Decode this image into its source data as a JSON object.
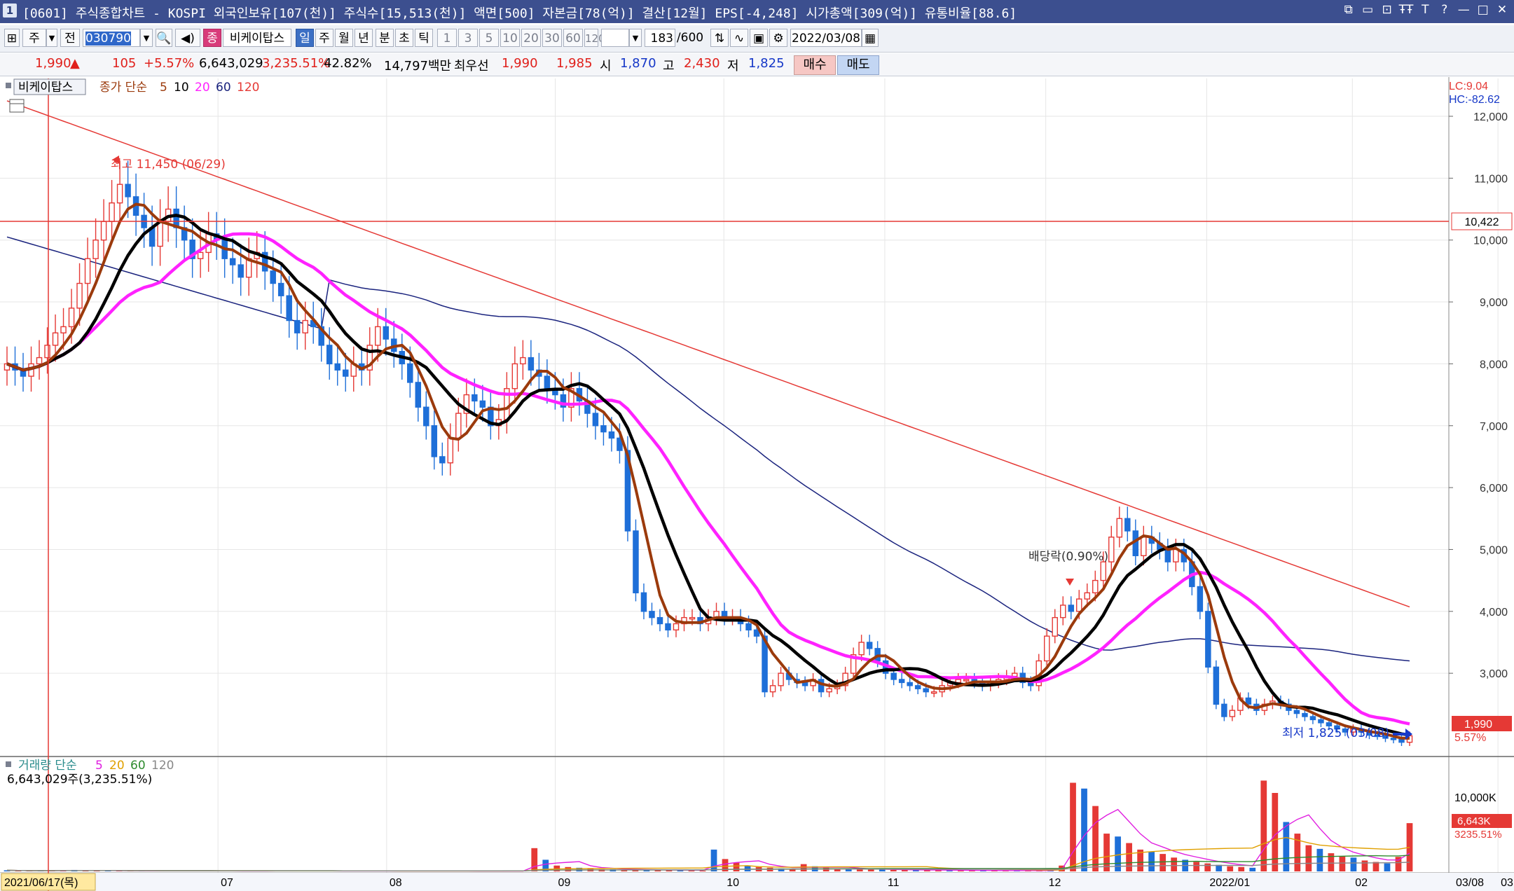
{
  "window": {
    "number": "1",
    "title": "[0601] 주식종합차트 - KOSPI 외국인보유[107(천)] 주식수[15,513(천)] 액면[500] 자본금[78(억)] 결산[12월] EPS[-4,248] 시가총액[309(억)] 유통비율[88.6]",
    "controls": [
      "⧉",
      "▭",
      "⊡",
      "ŦŦ",
      "T",
      "?",
      "—",
      "□",
      "✕"
    ]
  },
  "toolbar": {
    "period_selector": "주",
    "prev_button": "전",
    "code_input": "030790",
    "stock_badge": "종",
    "stock_name": "비케이탑스",
    "period_tabs": [
      "일",
      "주",
      "월",
      "년",
      "분",
      "초",
      "틱"
    ],
    "active_period": "일",
    "minute_values": [
      "1",
      "3",
      "5",
      "10",
      "20",
      "30",
      "60",
      "120"
    ],
    "count_display": "183",
    "count_total": "/600",
    "date_input": "2022/03/08"
  },
  "quote": {
    "price": "1,990",
    "direction": "▲",
    "change": "105",
    "change_pct": "+5.57%",
    "volume": "6,643,029",
    "volume_ratio": "3,235.51%",
    "turnover": "42.82%",
    "trade_amount": "14,797백만",
    "priority_label": "최우선",
    "ask": "1,990",
    "bid": "1,985",
    "open_label": "시",
    "open": "1,870",
    "high_label": "고",
    "high": "2,430",
    "low_label": "저",
    "low": "1,825",
    "buy_button": "매수",
    "sell_button": "매도"
  },
  "price_panel": {
    "stock_tag": "비케이탑스",
    "legend_prefix": "종가 단순",
    "ma_labels": [
      "5",
      "10",
      "20",
      "60",
      "120"
    ],
    "ma_colors": [
      "#9b3a0c",
      "#000000",
      "#ff22ff",
      "#1a237e",
      "#e53935"
    ],
    "lc": "LC:9.04",
    "hc": "HC:-82.62",
    "high_marker": "최고 11,450 (06/29)",
    "low_marker": "최저 1,825 (03/08)",
    "dividend_marker": "배당락(0.90%)",
    "crosshair_value": "10,422",
    "current_price": "1,990",
    "current_pct": "5.57%"
  },
  "volume_panel": {
    "legend_prefix": "거래량 단순",
    "ma_labels": [
      "5",
      "20",
      "60",
      "120"
    ],
    "ma_colors": [
      "#e020e0",
      "#e0a000",
      "#2e8b2e",
      "#888888"
    ],
    "volume_text": "6,643,029주(3,235.51%)",
    "axis_label": "10,000K",
    "current_volume": "6,643K",
    "current_ratio": "3235.51%"
  },
  "x_axis": {
    "start_label": "2021/06/17(목)",
    "month_labels": [
      "07",
      "08",
      "09",
      "10",
      "11",
      "12",
      "2022/01",
      "02",
      "03"
    ],
    "end_label": "03/08"
  },
  "chart_data": {
    "type": "candlestick",
    "y_ticks": [
      3000,
      4000,
      5000,
      6000,
      7000,
      8000,
      9000,
      10000,
      11000,
      12000
    ],
    "ylim": [
      1700,
      12600
    ],
    "close": [
      8000,
      7900,
      7800,
      8000,
      8100,
      8300,
      8500,
      8600,
      8900,
      9300,
      9700,
      10000,
      10300,
      10600,
      10900,
      10700,
      10400,
      10200,
      9900,
      10300,
      10500,
      10200,
      10000,
      9700,
      9800,
      10100,
      10000,
      9700,
      9600,
      9400,
      9700,
      9800,
      9500,
      9300,
      9100,
      8700,
      8500,
      8700,
      8600,
      8300,
      8000,
      7900,
      7800,
      8000,
      7900,
      8300,
      8600,
      8400,
      8200,
      8000,
      7700,
      7300,
      7000,
      6500,
      6400,
      6800,
      7200,
      7500,
      7400,
      7300,
      7000,
      7100,
      7600,
      8000,
      8100,
      7900,
      7800,
      7600,
      7500,
      7300,
      7600,
      7400,
      7200,
      7000,
      6900,
      6800,
      6600,
      5300,
      4300,
      4000,
      3900,
      3800,
      3700,
      3800,
      3900,
      3900,
      3800,
      3900,
      4000,
      3900,
      3900,
      3800,
      3700,
      3600,
      2700,
      2800,
      3000,
      2900,
      2850,
      2800,
      2900,
      2700,
      2750,
      2800,
      3000,
      3300,
      3500,
      3400,
      3200,
      3000,
      2900,
      2850,
      2800,
      2750,
      2700,
      2700,
      2800,
      2850,
      2900,
      2900,
      2850,
      2800,
      2850,
      2900,
      2950,
      3000,
      2850,
      2800,
      3200,
      3600,
      3900,
      4100,
      4000,
      4200,
      4300,
      4500,
      4800,
      5200,
      5500,
      5300,
      4900,
      5200,
      5100,
      5000,
      4800,
      5000,
      4800,
      4400,
      4000,
      3100,
      2500,
      2300,
      2400,
      2600,
      2500,
      2400,
      2500,
      2550,
      2500,
      2400,
      2350,
      2300,
      2250,
      2200,
      2150,
      2100,
      2050,
      2100,
      2050,
      2000,
      1990,
      1950,
      1930,
      1885,
      1990
    ],
    "ma5": [
      8400,
      8300,
      8000,
      8000,
      8100,
      8300,
      8500,
      8700,
      8900,
      9300,
      9700,
      10000,
      10300,
      10500,
      10600,
      10400,
      10300,
      10100,
      10000,
      9900,
      9800,
      9800,
      9700,
      9700,
      9600,
      9400,
      9200,
      9000,
      8900,
      8600,
      8500,
      8500,
      8300,
      8300,
      8200,
      8100,
      8000,
      8000,
      8000,
      8000,
      7900,
      7500,
      7200,
      7000,
      7000,
      7100,
      7200,
      7300,
      7400,
      7500,
      7700,
      7700,
      7800,
      7600,
      7500,
      7400,
      7300,
      7200,
      7000,
      6800,
      6600,
      6000,
      5500,
      5000,
      4500,
      4100,
      3900,
      3900,
      3900,
      4000,
      4000,
      3900,
      3900,
      3800,
      3700,
      3500,
      3200,
      3000,
      2900,
      2800,
      2800,
      2800,
      2900,
      3100,
      3200,
      3200,
      3100,
      2900,
      2800,
      2750,
      2700,
      2800,
      2900,
      3000,
      3000,
      3100,
      3300,
      3500,
      3600,
      3900,
      4100,
      4200,
      4400,
      4700,
      5000,
      5200,
      5100,
      5000,
      4900,
      4700,
      4300,
      3800,
      3200,
      2700,
      2500,
      2500,
      2500,
      2450,
      2400,
      2350,
      2300,
      2250,
      2200,
      2150,
      2100,
      2050,
      2000
    ],
    "volume_k": [
      150,
      100,
      80,
      90,
      120,
      130,
      200,
      100,
      90,
      80,
      80,
      70,
      70,
      60,
      60,
      80,
      70,
      70,
      60,
      60,
      60,
      60,
      60,
      60,
      80,
      70,
      70,
      60,
      60,
      60,
      60,
      50,
      60,
      60,
      60,
      50,
      50,
      50,
      60,
      60,
      60,
      40,
      40,
      40,
      60,
      60,
      60,
      3200,
      1600,
      800,
      600,
      500,
      400,
      300,
      300,
      200,
      200,
      200,
      200,
      200,
      150,
      120,
      100,
      3000,
      1700,
      1200,
      800,
      600,
      500,
      400,
      300,
      1000,
      700,
      500,
      400,
      300,
      300,
      250,
      250,
      200,
      200,
      180,
      180,
      160,
      150,
      130,
      120,
      120,
      110,
      110,
      110,
      110,
      110,
      130,
      800,
      12200,
      11400,
      9000,
      5200,
      4800,
      3900,
      3000,
      2700,
      2400,
      1900,
      1600,
      1300,
      1100,
      900,
      700,
      600,
      500,
      12500,
      10800,
      6800,
      5200,
      3600,
      3100,
      2500,
      2100,
      1900,
      1500,
      1300,
      1100,
      2000,
      6643
    ]
  }
}
